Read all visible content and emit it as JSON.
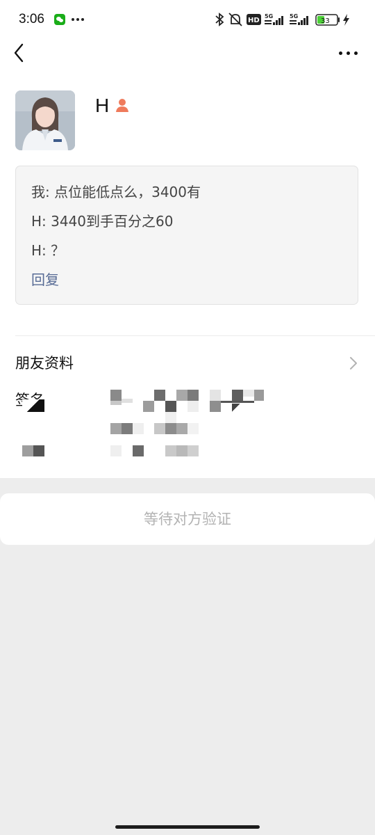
{
  "status_bar": {
    "time": "3:06",
    "battery": "33"
  },
  "profile": {
    "name": "H",
    "gender": "female"
  },
  "verification_messages": [
    {
      "line": "我: 点位能低点么，3400有"
    },
    {
      "line": "H: 3440到手百分之60"
    },
    {
      "line": "H: ？"
    }
  ],
  "reply_label": "回复",
  "rows": {
    "friend_info": "朋友资料",
    "signature": "签名"
  },
  "pending_button_label": "等待对方验证",
  "colors": {
    "link": "#576b95",
    "disabled_text": "#b3b3b3",
    "background": "#ededed"
  }
}
